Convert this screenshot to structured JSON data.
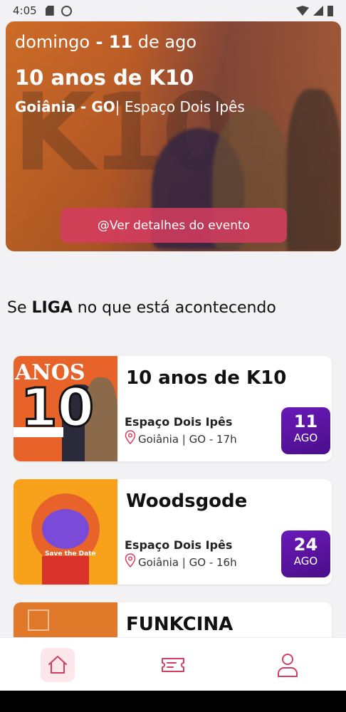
{
  "status_bar": {
    "time": "4:05"
  },
  "hero": {
    "date_prefix": "domingo",
    "date_separator": " - ",
    "date_main": "11",
    "date_suffix": " de ago",
    "title": "10 anos de K10",
    "city": "Goiânia - GO",
    "venue": "| Espaço Dois Ipês",
    "button_label": "@Ver detalhes do evento"
  },
  "section": {
    "prefix": "Se ",
    "highlight": "LIGA",
    "suffix": " no que está acontecendo"
  },
  "events": [
    {
      "name": "10 anos de K10",
      "venue": "Espaço Dois Ipês",
      "city": "Goiânia | GO - 17h",
      "day": "11",
      "month": "AGO"
    },
    {
      "name": "Woodsgode",
      "venue": "Espaço Dois Ipês",
      "city": "Goiânia | GO - 16h",
      "day": "24",
      "month": "AGO"
    },
    {
      "name": "FUNKCINA"
    }
  ],
  "thumbs": {
    "event1_text": "ANOS",
    "event1_number": "10",
    "event2_text": "Save the Date"
  },
  "colors": {
    "accent": "#d63c60",
    "badge": "#5a14a0",
    "hero_bg": "#c8622a"
  }
}
